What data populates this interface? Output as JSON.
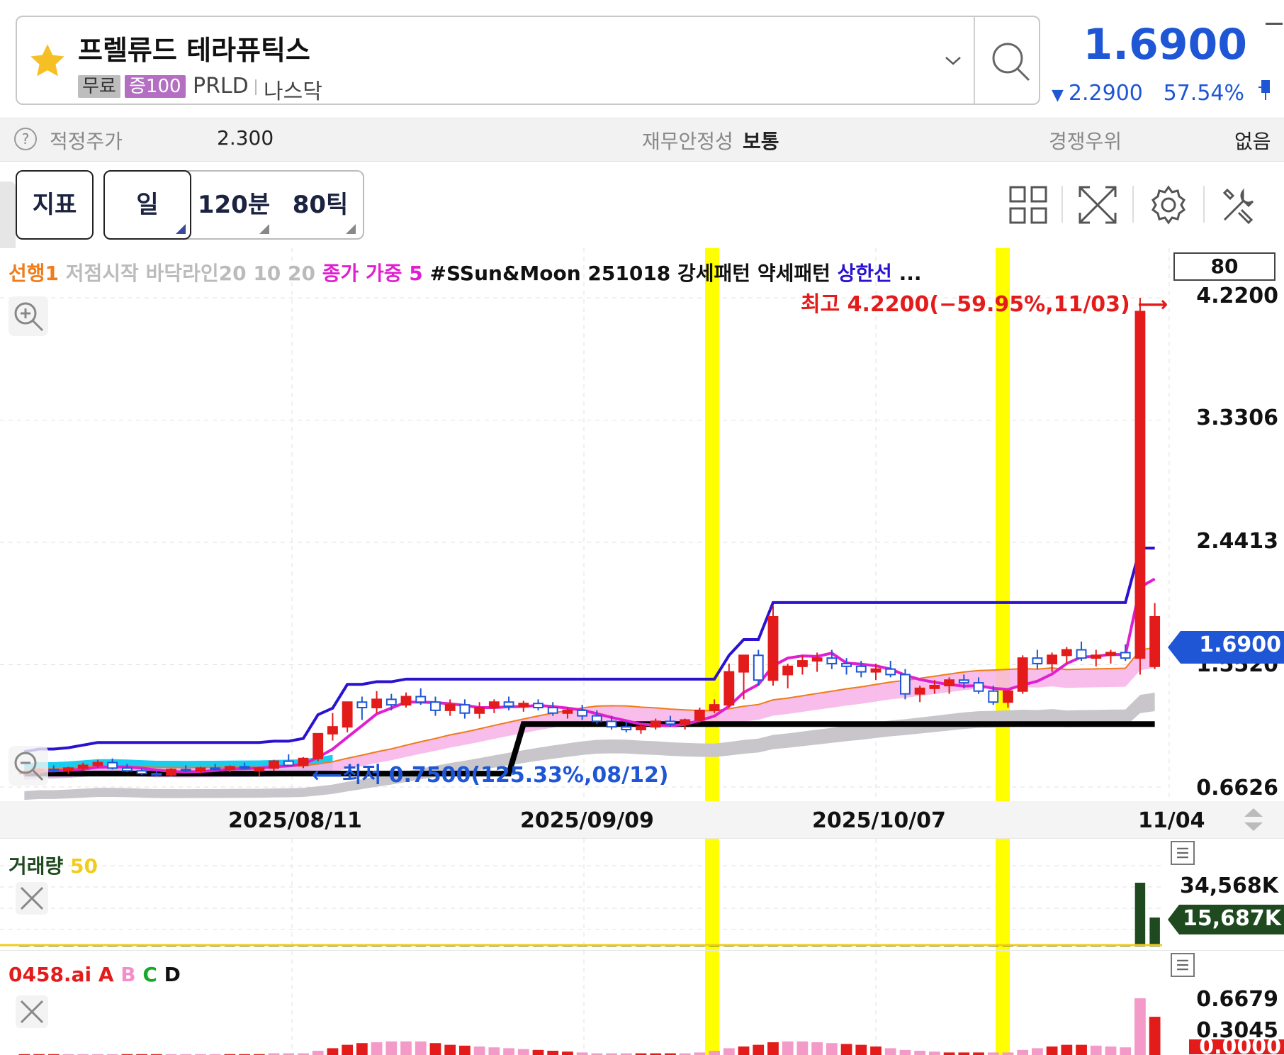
{
  "header": {
    "stock_name": "프렐류드 테라퓨틱스",
    "badge_free": "무료",
    "badge_margin": "증100",
    "ticker": "PRLD",
    "exchange": "나스닥",
    "price": "1.6900",
    "change": "2.2900",
    "change_pct": "57.54%",
    "price_color": "#1e56d6"
  },
  "info_bar": {
    "fair_price_label": "적정주가",
    "fair_price_value": "2.300",
    "stability_label": "재무안정성",
    "stability_value": "보통",
    "advantage_label": "경쟁우위",
    "advantage_value": "없음"
  },
  "toolbar": {
    "indicator_label": "지표",
    "period_day": "일",
    "period_120": "120분",
    "period_tick": "80틱"
  },
  "chart_legend": {
    "lead": "선행1",
    "low_start": "저점시작",
    "bottom_line": "바닥라인20",
    "nums": "10  20",
    "close_weighted": "종가 가중 5",
    "sun_moon": "#SSun&Moon 251018",
    "strong_pattern": "강세패턴",
    "weak_pattern": "약세패턴",
    "upper_limit": "상한선",
    "ellipsis": "...",
    "count_box": "80"
  },
  "annotations": {
    "high": "최고 4.2200(−59.95%,11/03)",
    "low": "최저 0.7500(125.33%,08/12)",
    "current_tag": "1.6900",
    "volume_tag": "15,687K"
  },
  "colors": {
    "up": "#e31b1b",
    "down": "#1e56d6",
    "highlight": "#ffff00",
    "ma_blue": "#2a12d0",
    "ma_magenta": "#e020d0",
    "cloud": "#f7b6e8",
    "cyan": "#00c8f0",
    "volume": "#1f4a1f"
  },
  "chart_data": [
    {
      "type": "candlestick",
      "y_ticks": [
        "4.2200",
        "3.3306",
        "2.4413",
        "1.5520",
        "0.6626"
      ],
      "ylim": [
        0.6626,
        4.22
      ],
      "x_ticks": [
        "2025/08/11",
        "2025/09/09",
        "2025/10/07",
        "11/04"
      ],
      "high": {
        "value": 4.22,
        "date": "11/03"
      },
      "low": {
        "value": 0.75,
        "date": "08/12"
      },
      "last": 1.69,
      "candles": [
        [
          0.76,
          0.78,
          0.74,
          0.77
        ],
        [
          0.77,
          0.8,
          0.75,
          0.79
        ],
        [
          0.79,
          0.82,
          0.77,
          0.78
        ],
        [
          0.78,
          0.81,
          0.76,
          0.8
        ],
        [
          0.8,
          0.84,
          0.78,
          0.82
        ],
        [
          0.82,
          0.86,
          0.8,
          0.84
        ],
        [
          0.84,
          0.87,
          0.79,
          0.8
        ],
        [
          0.8,
          0.83,
          0.77,
          0.78
        ],
        [
          0.78,
          0.8,
          0.75,
          0.76
        ],
        [
          0.76,
          0.78,
          0.74,
          0.75
        ],
        [
          0.75,
          0.8,
          0.74,
          0.79
        ],
        [
          0.79,
          0.82,
          0.77,
          0.78
        ],
        [
          0.78,
          0.81,
          0.76,
          0.8
        ],
        [
          0.8,
          0.83,
          0.78,
          0.79
        ],
        [
          0.79,
          0.82,
          0.77,
          0.81
        ],
        [
          0.81,
          0.84,
          0.79,
          0.8
        ],
        [
          0.78,
          0.81,
          0.74,
          0.8
        ],
        [
          0.8,
          0.86,
          0.78,
          0.85
        ],
        [
          0.85,
          0.9,
          0.83,
          0.82
        ],
        [
          0.82,
          0.88,
          0.8,
          0.87
        ],
        [
          0.87,
          0.93,
          0.85,
          1.05
        ],
        [
          1.05,
          1.2,
          1.0,
          1.1
        ],
        [
          1.1,
          1.22,
          1.06,
          1.28
        ],
        [
          1.28,
          1.32,
          1.15,
          1.24
        ],
        [
          1.24,
          1.36,
          1.2,
          1.3
        ],
        [
          1.3,
          1.34,
          1.22,
          1.26
        ],
        [
          1.26,
          1.35,
          1.24,
          1.32
        ],
        [
          1.32,
          1.38,
          1.26,
          1.28
        ],
        [
          1.28,
          1.32,
          1.18,
          1.22
        ],
        [
          1.22,
          1.3,
          1.18,
          1.26
        ],
        [
          1.26,
          1.3,
          1.16,
          1.2
        ],
        [
          1.2,
          1.28,
          1.16,
          1.24
        ],
        [
          1.24,
          1.3,
          1.2,
          1.28
        ],
        [
          1.28,
          1.32,
          1.22,
          1.25
        ],
        [
          1.25,
          1.29,
          1.21,
          1.27
        ],
        [
          1.27,
          1.3,
          1.22,
          1.24
        ],
        [
          1.24,
          1.28,
          1.18,
          1.2
        ],
        [
          1.2,
          1.24,
          1.16,
          1.22
        ],
        [
          1.22,
          1.26,
          1.15,
          1.18
        ],
        [
          1.18,
          1.22,
          1.12,
          1.14
        ],
        [
          1.14,
          1.18,
          1.08,
          1.1
        ],
        [
          1.1,
          1.14,
          1.06,
          1.08
        ],
        [
          1.08,
          1.12,
          1.05,
          1.1
        ],
        [
          1.1,
          1.16,
          1.08,
          1.14
        ],
        [
          1.14,
          1.18,
          1.1,
          1.12
        ],
        [
          1.12,
          1.16,
          1.08,
          1.15
        ],
        [
          1.15,
          1.24,
          1.13,
          1.22
        ],
        [
          1.22,
          1.3,
          1.2,
          1.26
        ],
        [
          1.26,
          1.56,
          1.24,
          1.5
        ],
        [
          1.5,
          1.58,
          1.3,
          1.62
        ],
        [
          1.62,
          1.66,
          1.4,
          1.44
        ],
        [
          1.44,
          1.98,
          1.4,
          1.9
        ],
        [
          1.48,
          1.56,
          1.38,
          1.54
        ],
        [
          1.54,
          1.62,
          1.48,
          1.58
        ],
        [
          1.58,
          1.64,
          1.5,
          1.6
        ],
        [
          1.6,
          1.66,
          1.52,
          1.56
        ],
        [
          1.56,
          1.6,
          1.48,
          1.54
        ],
        [
          1.54,
          1.58,
          1.46,
          1.5
        ],
        [
          1.5,
          1.56,
          1.44,
          1.52
        ],
        [
          1.52,
          1.58,
          1.46,
          1.48
        ],
        [
          1.48,
          1.52,
          1.3,
          1.34
        ],
        [
          1.34,
          1.4,
          1.28,
          1.38
        ],
        [
          1.38,
          1.44,
          1.34,
          1.4
        ],
        [
          1.4,
          1.46,
          1.34,
          1.44
        ],
        [
          1.44,
          1.48,
          1.38,
          1.42
        ],
        [
          1.42,
          1.46,
          1.34,
          1.36
        ],
        [
          1.36,
          1.4,
          1.26,
          1.28
        ],
        [
          1.28,
          1.34,
          1.24,
          1.36
        ],
        [
          1.36,
          1.62,
          1.34,
          1.6
        ],
        [
          1.6,
          1.66,
          1.52,
          1.56
        ],
        [
          1.56,
          1.64,
          1.5,
          1.62
        ],
        [
          1.62,
          1.68,
          1.56,
          1.66
        ],
        [
          1.66,
          1.72,
          1.58,
          1.6
        ],
        [
          1.6,
          1.66,
          1.54,
          1.62
        ],
        [
          1.62,
          1.66,
          1.56,
          1.64
        ],
        [
          1.64,
          1.7,
          1.58,
          1.6
        ],
        [
          1.6,
          4.22,
          1.48,
          4.12
        ],
        [
          1.54,
          2.0,
          1.52,
          1.9
        ]
      ]
    },
    {
      "type": "bar",
      "title": "거래량",
      "period": "50",
      "y_ticks": [
        "34,568K"
      ],
      "last": "15,687K",
      "values_k": [
        120,
        150,
        130,
        160,
        140,
        180,
        200,
        170,
        150,
        140,
        160,
        150,
        180,
        200,
        190,
        170,
        150,
        160,
        180,
        200,
        300,
        350,
        280,
        260,
        240,
        230,
        250,
        220,
        210,
        200,
        220,
        210,
        200,
        190,
        180,
        200,
        210,
        190,
        180,
        170,
        160,
        170,
        180,
        190,
        200,
        210,
        230,
        260,
        500,
        450,
        400,
        700,
        380,
        350,
        330,
        300,
        320,
        310,
        290,
        280,
        300,
        320,
        340,
        310,
        300,
        320,
        350,
        380,
        600,
        500,
        450,
        420,
        400,
        380,
        360,
        340,
        34568,
        15687
      ]
    },
    {
      "type": "bar",
      "title": "0458.ai",
      "series_labels": [
        "A",
        "B",
        "C",
        "D"
      ],
      "y_ticks": [
        "0.6679",
        "0.3045",
        "0.0000"
      ],
      "values": [
        0.01,
        0.01,
        0.01,
        0.01,
        0.01,
        0.01,
        0.01,
        0.01,
        0.01,
        0.01,
        0.01,
        0.01,
        0.01,
        0.01,
        0.01,
        0.01,
        0.01,
        0.02,
        0.02,
        0.02,
        0.05,
        0.08,
        0.12,
        0.14,
        0.15,
        0.16,
        0.16,
        0.16,
        0.14,
        0.12,
        0.11,
        0.1,
        0.09,
        0.08,
        0.07,
        0.06,
        0.05,
        0.04,
        0.03,
        0.02,
        0.02,
        0.02,
        0.02,
        0.02,
        0.02,
        0.02,
        0.03,
        0.05,
        0.08,
        0.1,
        0.12,
        0.15,
        0.16,
        0.16,
        0.15,
        0.14,
        0.13,
        0.12,
        0.1,
        0.08,
        0.06,
        0.05,
        0.04,
        0.03,
        0.03,
        0.03,
        0.03,
        0.03,
        0.06,
        0.08,
        0.1,
        0.12,
        0.12,
        0.11,
        0.1,
        0.09,
        0.6679,
        0.45
      ]
    }
  ]
}
